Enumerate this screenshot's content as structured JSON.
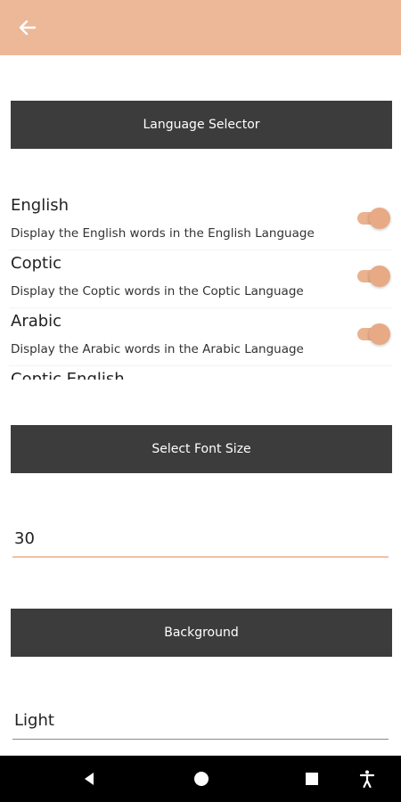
{
  "app_bar": {
    "back_icon": "arrow-back-icon",
    "color": "#ecb898"
  },
  "sections": {
    "language_selector": "Language Selector",
    "font_size": "Select Font Size",
    "background": "Background"
  },
  "languages": [
    {
      "title": "English",
      "description": "Display the English words in the English Language",
      "enabled": true
    },
    {
      "title": "Coptic",
      "description": "Display the Coptic words in the Coptic Language",
      "enabled": true
    },
    {
      "title": "Arabic",
      "description": "Display the Arabic words in the Arabic Language",
      "enabled": true
    },
    {
      "title": "Coptic English",
      "description": "",
      "enabled": true
    }
  ],
  "font_size": {
    "value": "30"
  },
  "background": {
    "value": "Light"
  },
  "colors": {
    "accent": "#ecb898",
    "button_bg": "#3c3c3c"
  },
  "nav_bar": {
    "icons": [
      "triangle-back-icon",
      "circle-home-icon",
      "square-recents-icon",
      "accessibility-icon"
    ]
  }
}
